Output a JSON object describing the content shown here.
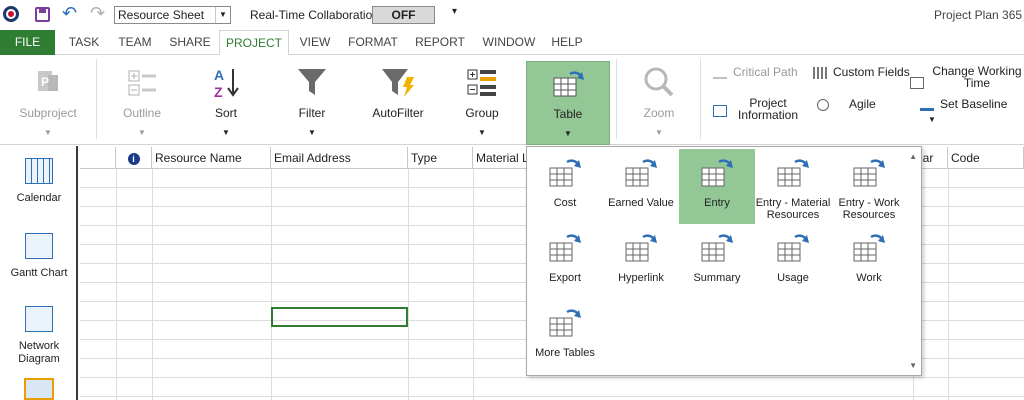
{
  "quick_access": {
    "view_combo_value": "Resource Sheet",
    "collaboration_label": "Real-Time Collaboration",
    "collaboration_toggle": "OFF"
  },
  "document_title": "Project Plan 365 -",
  "tabs": [
    {
      "label": "FILE"
    },
    {
      "label": "TASK"
    },
    {
      "label": "TEAM"
    },
    {
      "label": "SHARE"
    },
    {
      "label": "PROJECT"
    },
    {
      "label": "VIEW"
    },
    {
      "label": "FORMAT"
    },
    {
      "label": "REPORT"
    },
    {
      "label": "WINDOW"
    },
    {
      "label": "HELP"
    }
  ],
  "ribbon": {
    "subproject": "Subproject",
    "outline": "Outline",
    "sort": "Sort",
    "filter": "Filter",
    "autofilter": "AutoFilter",
    "group": "Group",
    "table": "Table",
    "zoom": "Zoom",
    "critical_path": "Critical Path",
    "custom_fields": "Custom Fields",
    "change_working_time": "Change Working Time",
    "project_information": "Project Information",
    "agile": "Agile",
    "set_baseline": "Set Baseline"
  },
  "viewbar": [
    {
      "label": "Calendar"
    },
    {
      "label": "Gantt Chart"
    },
    {
      "label": "Network Diagram"
    }
  ],
  "grid": {
    "info_header": "i",
    "columns": [
      "Resource Name",
      "Email Address",
      "Type",
      "Material L",
      "dar",
      "Code"
    ]
  },
  "table_gallery": {
    "items": [
      {
        "label": "Cost"
      },
      {
        "label": "Earned Value"
      },
      {
        "label": "Entry"
      },
      {
        "label": "Entry - Material Resources"
      },
      {
        "label": "Entry - Work Resources"
      },
      {
        "label": "Export"
      },
      {
        "label": "Hyperlink"
      },
      {
        "label": "Summary"
      },
      {
        "label": "Usage"
      },
      {
        "label": "Work"
      },
      {
        "label": "More Tables"
      }
    ],
    "selected": "Entry"
  },
  "colors": {
    "accent_green": "#2e7d32",
    "selected_green": "#94c796",
    "icon_blue": "#2f6fb5"
  }
}
